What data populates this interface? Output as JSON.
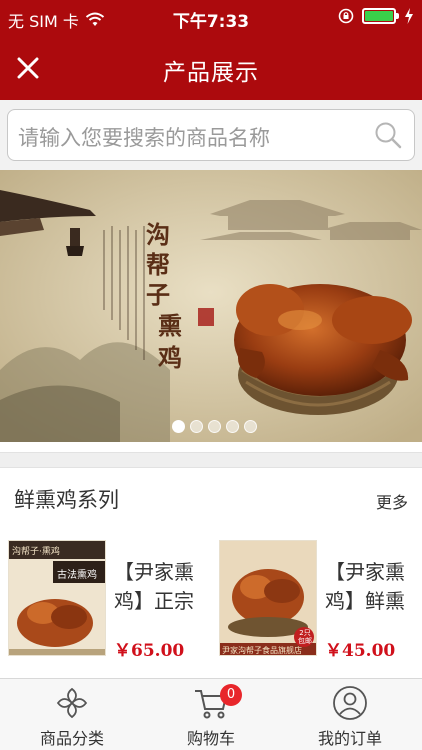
{
  "status_bar": {
    "carrier": "无 SIM 卡",
    "time": "下午7:33"
  },
  "header": {
    "title": "产品展示"
  },
  "search": {
    "placeholder": "请输入您要搜索的商品名称"
  },
  "banner": {
    "brand_name": "沟帮子",
    "product_name": "熏鸡",
    "slide_count": 5,
    "active_slide": 1
  },
  "section": {
    "title": "鲜熏鸡系列",
    "more_label": "更多"
  },
  "products": [
    {
      "name": "【尹家熏鸡】正宗",
      "price": "￥65.00",
      "thumb_text": "沟帮子·熏鸡",
      "thumb_badge": "古法熏鸡"
    },
    {
      "name": "【尹家熏鸡】鲜熏",
      "price": "￥45.00",
      "thumb_text": "尹家沟帮子食品旗舰店",
      "thumb_badge": "2只包邮"
    }
  ],
  "tabbar": {
    "tabs": [
      {
        "label": "商品分类",
        "icon": "category-icon"
      },
      {
        "label": "购物车",
        "icon": "cart-icon"
      },
      {
        "label": "我的订单",
        "icon": "user-icon"
      }
    ],
    "cart_count": "0"
  },
  "colors": {
    "brand_red": "#ac0a0d",
    "price_red": "#d0101b",
    "battery_green": "#3ad04a"
  }
}
